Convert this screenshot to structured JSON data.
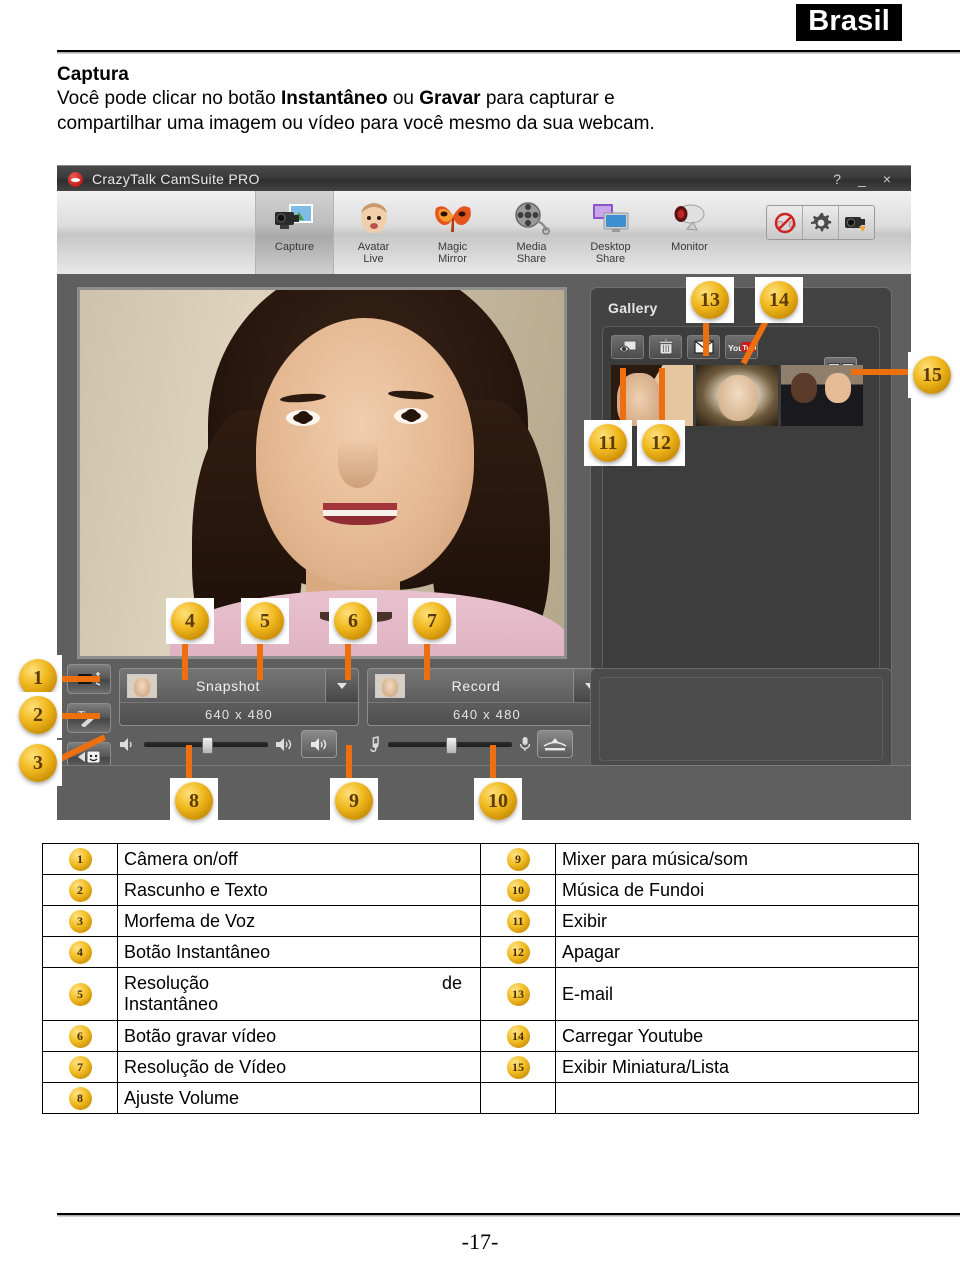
{
  "page": {
    "country_tab": "Brasil",
    "page_number": "-17-"
  },
  "intro": {
    "heading": "Captura",
    "line1_a": "Você pode clicar no botão ",
    "line1_b": "Instantâneo",
    "line1_c": " ou ",
    "line1_d": "Gravar",
    "line1_e": " para capturar e",
    "line2": "compartilhar uma imagem ou vídeo para você mesmo da sua webcam."
  },
  "app": {
    "title": "CrazyTalk CamSuite PRO",
    "window_controls": {
      "help": "?",
      "minimize": "_",
      "close": "×"
    },
    "ribbon": [
      {
        "label_line1": "Capture",
        "label_line2": "",
        "icon": "camcorder-photo-icon",
        "selected": true
      },
      {
        "label_line1": "Avatar",
        "label_line2": "Live",
        "icon": "baby-face-icon",
        "selected": false
      },
      {
        "label_line1": "Magic",
        "label_line2": "Mirror",
        "icon": "mask-icon",
        "selected": false
      },
      {
        "label_line1": "Media",
        "label_line2": "Share",
        "icon": "film-reel-icon",
        "selected": false
      },
      {
        "label_line1": "Desktop",
        "label_line2": "Share",
        "icon": "monitor-icon",
        "selected": false
      },
      {
        "label_line1": "Monitor",
        "label_line2": "",
        "icon": "webcam-icon",
        "selected": false
      }
    ],
    "ribbon_right_buttons": [
      {
        "icon": "no-emoticon-icon"
      },
      {
        "icon": "gear-icon"
      },
      {
        "icon": "camera-settings-icon"
      }
    ],
    "left_buttons": [
      {
        "icon": "camera-onoff-icon"
      },
      {
        "icon": "text-draw-icon"
      },
      {
        "icon": "voice-morph-icon"
      }
    ],
    "gallery": {
      "title": "Gallery",
      "tool_buttons": [
        {
          "icon": "show-icon"
        },
        {
          "icon": "trash-icon"
        },
        {
          "icon": "email-icon"
        },
        {
          "icon": "youtube-icon"
        }
      ],
      "view_toggle_icon": "thumbnail-list-toggle-icon",
      "thumbnails": [
        "thumbnail-woman-dark-hair",
        "thumbnail-woman-blonde",
        "thumbnail-two-men"
      ]
    },
    "capture": {
      "snapshot": {
        "label": "Snapshot",
        "resolution": "640 x 480",
        "dropdown_icon": "chevron-down-icon"
      },
      "record": {
        "label": "Record",
        "resolution": "640 x 480",
        "dropdown_icon": "chevron-down-icon"
      }
    },
    "sliders": {
      "volume": {
        "left_icon": "speaker-low-icon",
        "right_icon": "speaker-high-icon",
        "button_icon": "speaker-mute-icon"
      },
      "music": {
        "left_icon": "music-note-icon",
        "right_icon": "mic-icon",
        "button_icon": "voice-morph-btn-icon"
      }
    },
    "player": {
      "play_icon": "play-icon",
      "folder_icon": "folder-icon"
    }
  },
  "callouts": [
    {
      "n": "1"
    },
    {
      "n": "2"
    },
    {
      "n": "3"
    },
    {
      "n": "4"
    },
    {
      "n": "5"
    },
    {
      "n": "6"
    },
    {
      "n": "7"
    },
    {
      "n": "8"
    },
    {
      "n": "9"
    },
    {
      "n": "10"
    },
    {
      "n": "11"
    },
    {
      "n": "12"
    },
    {
      "n": "13"
    },
    {
      "n": "14"
    },
    {
      "n": "15"
    }
  ],
  "legend": {
    "rows": [
      {
        "ln": "1",
        "ltext": "Câmera on/off",
        "rn": "9",
        "rtext": "Mixer para música/som"
      },
      {
        "ln": "2",
        "ltext": "Rascunho e Texto",
        "rn": "10",
        "rtext": "Música de Fundoi"
      },
      {
        "ln": "3",
        "ltext": "Morfema de Voz",
        "rn": "11",
        "rtext": "Exibir"
      },
      {
        "ln": "4",
        "ltext": "Botão Instantâneo",
        "rn": "12",
        "rtext": "Apagar"
      },
      {
        "ln": "5",
        "ltext": "Resolução",
        "ltext2": "de",
        "ltext3": "Instantâneo",
        "rn": "13",
        "rtext": "E-mail",
        "tall": true
      },
      {
        "ln": "6",
        "ltext": "Botão gravar vídeo",
        "rn": "14",
        "rtext": "Carregar Youtube"
      },
      {
        "ln": "7",
        "ltext": "Resolução de Vídeo",
        "rn": "15",
        "rtext": "Exibir Miniatura/Lista"
      },
      {
        "ln": "8",
        "ltext": "Ajuste Volume",
        "rn": "",
        "rtext": ""
      }
    ]
  }
}
